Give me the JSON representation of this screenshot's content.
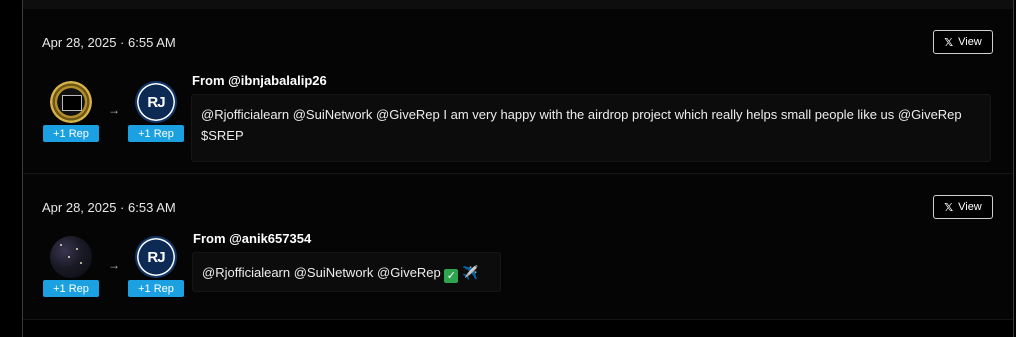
{
  "feed": {
    "items": [
      {
        "timestamp": "Apr 28, 2025 · 6:55 AM",
        "view_label": "View",
        "from_label": "From @ibnjabalalip26",
        "message": "@Rjofficialearn @SuiNetwork @GiveRep I am very happy with the airdrop project which really helps small people like us @GiveRep $SREP",
        "giver_rep": "+1 Rep",
        "receiver_rep": "+1 Rep",
        "arrow": "→",
        "receiver_initials": "RJ"
      },
      {
        "timestamp": "Apr 28, 2025 · 6:53 AM",
        "view_label": "View",
        "from_label": "From @anik657354",
        "message": "@Rjofficialearn @SuiNetwork @GiveRep",
        "check_emoji": "✓",
        "plane_emoji": "✈️",
        "giver_rep": "+1 Rep",
        "receiver_rep": "+1 Rep",
        "arrow": "→",
        "receiver_initials": "RJ"
      }
    ]
  },
  "icons": {
    "x_logo": "x-logo-icon",
    "arrow": "arrow-right-icon"
  },
  "colors": {
    "background": "#000000",
    "rep_badge": "#1ba1e2",
    "card": "#050505"
  }
}
